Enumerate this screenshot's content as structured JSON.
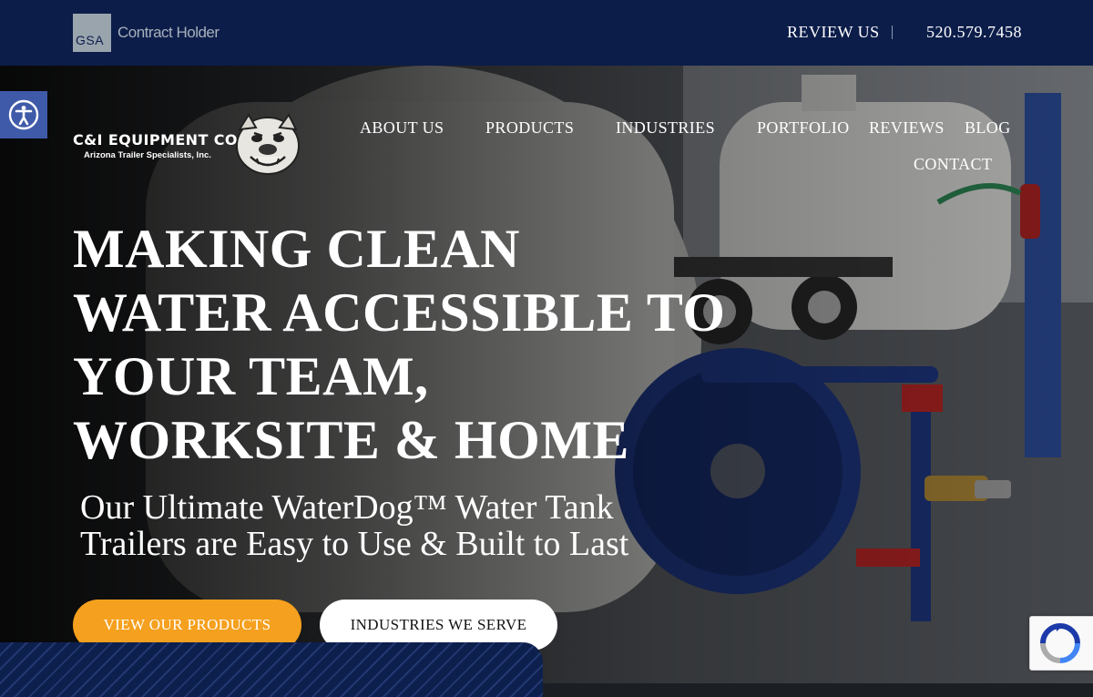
{
  "topbar": {
    "gsa_badge": "GSA",
    "gsa_label": "Contract Holder",
    "review_link": "REVIEW US",
    "phone": "520.579.7458"
  },
  "brand": {
    "name": "C&I EQUIPMENT CO.",
    "tagline": "Arizona Trailer Specialists, Inc."
  },
  "nav": {
    "items": [
      {
        "label": "ABOUT US"
      },
      {
        "label": "PRODUCTS"
      },
      {
        "label": "INDUSTRIES"
      },
      {
        "label": "PORTFOLIO"
      },
      {
        "label": "REVIEWS"
      },
      {
        "label": "BLOG"
      },
      {
        "label": "CONTACT"
      }
    ]
  },
  "hero": {
    "headline": "MAKING CLEAN WATER ACCESSIBLE TO YOUR TEAM, WORKSITE & HOME",
    "subheadline": "Our Ultimate WaterDog™ Water Tank Trailers are Easy to Use & Built to Last",
    "primary_cta": "VIEW OUR PRODUCTS",
    "secondary_cta": "INDUSTRIES WE SERVE"
  },
  "colors": {
    "topbar_bg": "#0c1d4a",
    "accent_orange": "#f5a01e",
    "accessibility_blue": "#3f5aa8",
    "reel_blue": "#1f3a8a"
  },
  "icons": [
    "accessibility-icon",
    "bulldog-mascot-icon",
    "recaptcha-icon"
  ]
}
